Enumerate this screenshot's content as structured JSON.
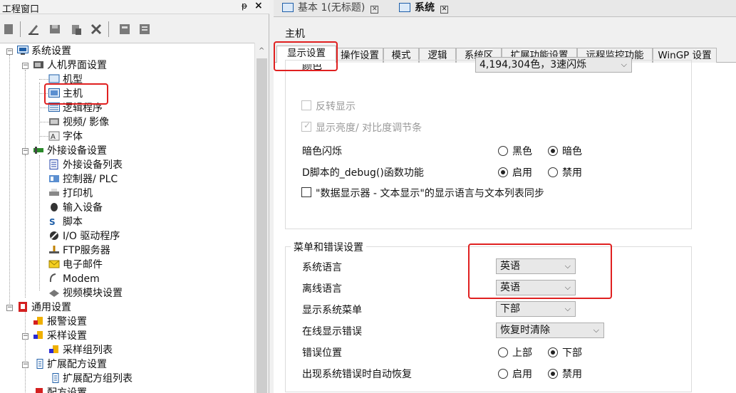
{
  "left_panel": {
    "title": "工程窗口",
    "pin": "ᵽ",
    "close": "×",
    "tree": [
      {
        "label": "系统设置"
      },
      {
        "label": "人机界面设置"
      },
      {
        "label": "机型"
      },
      {
        "label": "主机"
      },
      {
        "label": "逻辑程序"
      },
      {
        "label": "视频/ 影像"
      },
      {
        "label": "字体"
      },
      {
        "label": "外接设备设置"
      },
      {
        "label": "外接设备列表"
      },
      {
        "label": "控制器/ PLC"
      },
      {
        "label": "打印机"
      },
      {
        "label": "输入设备"
      },
      {
        "label": "脚本"
      },
      {
        "label": "I/O 驱动程序"
      },
      {
        "label": "FTP服务器"
      },
      {
        "label": "电子邮件"
      },
      {
        "label": "Modem"
      },
      {
        "label": "视频模块设置"
      },
      {
        "label": "通用设置"
      },
      {
        "label": "报警设置"
      },
      {
        "label": "采样设置"
      },
      {
        "label": "采样组列表"
      },
      {
        "label": "扩展配方设置"
      },
      {
        "label": "扩展配方组列表"
      },
      {
        "label": "配方设置"
      }
    ]
  },
  "doc_tabs": [
    {
      "label": "基本 1(无标题)"
    },
    {
      "label": "系统"
    }
  ],
  "page_label": "主机",
  "tabs": [
    {
      "label": "显示设置"
    },
    {
      "label": "操作设置"
    },
    {
      "label": "模式"
    },
    {
      "label": "逻辑"
    },
    {
      "label": "系统区"
    },
    {
      "label": "扩展功能设置"
    },
    {
      "label": "远程监控功能"
    },
    {
      "label": "WinGP 设置"
    }
  ],
  "display": {
    "color_label": "颜色",
    "color_value": "4,194,304色，3速闪烁",
    "reverse": "反转显示",
    "brightness": "显示亮度/ 对比度调节条",
    "blink_label": "暗色闪烁",
    "blink_black": "黑色",
    "blink_dark": "暗色",
    "debug_label": "D脚本的_debug()函数功能",
    "debug_enable": "启用",
    "debug_disable": "禁用",
    "sync_label": "\"数据显示器 - 文本显示\"的显示语言与文本列表同步"
  },
  "menu_error": {
    "group_title": "菜单和错误设置",
    "system_lang_label": "系统语言",
    "system_lang_value": "英语",
    "offline_lang_label": "离线语言",
    "offline_lang_value": "英语",
    "sys_menu_label": "显示系统菜单",
    "sys_menu_value": "下部",
    "online_err_label": "在线显示错误",
    "online_err_value": "恢复时清除",
    "err_pos_label": "错误位置",
    "err_pos_top": "上部",
    "err_pos_bottom": "下部",
    "auto_recover_label": "出现系统错误时自动恢复",
    "auto_recover_enable": "启用",
    "auto_recover_disable": "禁用"
  },
  "colors": {
    "highlight": "#e02020",
    "selection": "#0a64c8"
  }
}
